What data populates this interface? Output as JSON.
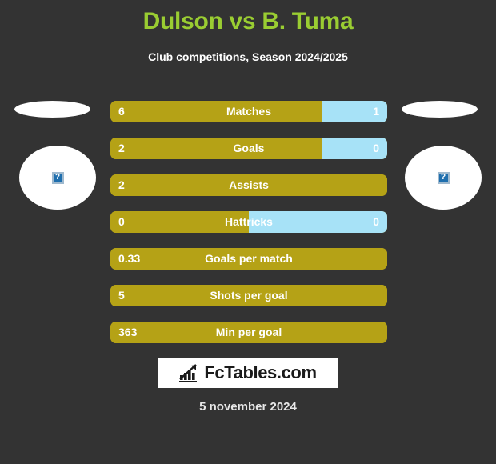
{
  "header": {
    "title": "Dulson vs B. Tuma",
    "subtitle": "Club competitions, Season 2024/2025",
    "title_color": "#9ACD32"
  },
  "players": {
    "home": {
      "flag_alt": "flag-placeholder",
      "photo_alt": "broken-image",
      "photo_glyph": "?"
    },
    "away": {
      "flag_alt": "flag-placeholder",
      "photo_alt": "broken-image",
      "photo_glyph": "?"
    }
  },
  "colors": {
    "background": "#333333",
    "home_bar": "#B5A216",
    "away_bar": "#A7E2F7",
    "label_text": "#FFFFFF"
  },
  "chart_data": {
    "type": "bar",
    "title": "Dulson vs B. Tuma",
    "subtitle": "Club competitions, Season 2024/2025",
    "orientation": "horizontal-paired",
    "series": [
      {
        "name": "Dulson",
        "color": "#B5A216"
      },
      {
        "name": "B. Tuma",
        "color": "#A7E2F7"
      }
    ],
    "categories": [
      "Matches",
      "Goals",
      "Assists",
      "Hattricks",
      "Goals per match",
      "Shots per goal",
      "Min per goal"
    ],
    "rows": [
      {
        "label": "Matches",
        "home": "6",
        "away": "1",
        "home_pct": 76.5,
        "away_pct": 23.5
      },
      {
        "label": "Goals",
        "home": "2",
        "away": "0",
        "home_pct": 76.5,
        "away_pct": 23.5
      },
      {
        "label": "Assists",
        "home": "2",
        "away": "",
        "home_pct": 100,
        "away_pct": 0
      },
      {
        "label": "Hattricks",
        "home": "0",
        "away": "0",
        "home_pct": 50,
        "away_pct": 50
      },
      {
        "label": "Goals per match",
        "home": "0.33",
        "away": "",
        "home_pct": 100,
        "away_pct": 0
      },
      {
        "label": "Shots per goal",
        "home": "5",
        "away": "",
        "home_pct": 100,
        "away_pct": 0
      },
      {
        "label": "Min per goal",
        "home": "363",
        "away": "",
        "home_pct": 100,
        "away_pct": 0
      }
    ]
  },
  "footer": {
    "logo_text": "FcTables.com",
    "logo_icon": "bar-chart-icon",
    "date": "5 november 2024"
  }
}
